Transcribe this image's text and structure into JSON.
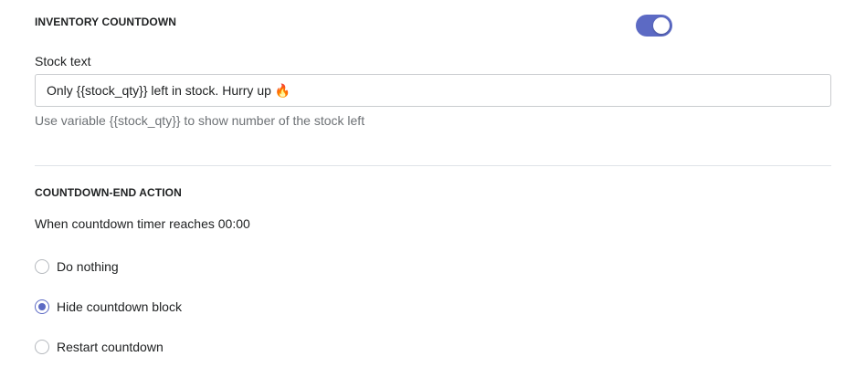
{
  "inventory_countdown": {
    "title": "INVENTORY COUNTDOWN",
    "toggle_on": true,
    "stock_text_label": "Stock text",
    "stock_text_value": "Only {{stock_qty}} left in stock. Hurry up 🔥",
    "help_text": "Use variable {{stock_qty}} to show number of the stock left"
  },
  "countdown_end_action": {
    "title": "COUNTDOWN-END ACTION",
    "subtext": "When countdown timer reaches 00:00",
    "options": [
      {
        "label": "Do nothing",
        "checked": false
      },
      {
        "label": "Hide countdown block",
        "checked": true
      },
      {
        "label": "Restart countdown",
        "checked": false
      }
    ]
  },
  "colors": {
    "accent": "#5c6ac4",
    "text": "#202223",
    "muted": "#6d7175",
    "border": "#c9cccf"
  }
}
